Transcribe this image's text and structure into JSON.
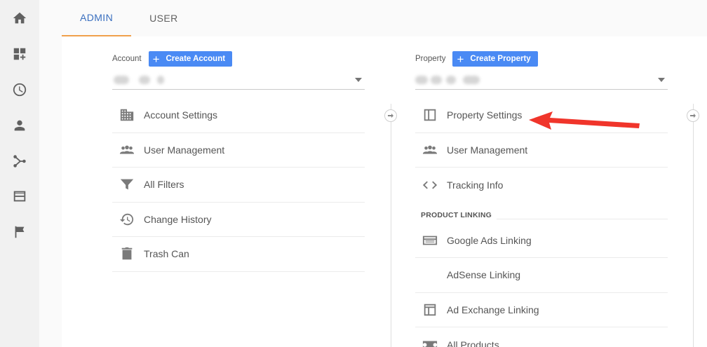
{
  "rail": {
    "icons": [
      "home-icon",
      "dashboards-icon",
      "realtime-icon",
      "audience-icon",
      "acquisition-icon",
      "behavior-icon",
      "conversions-icon"
    ]
  },
  "tabs": [
    {
      "label": "ADMIN",
      "active": true
    },
    {
      "label": "USER",
      "active": false
    }
  ],
  "account": {
    "label": "Account",
    "create_label": "Create Account",
    "items": [
      {
        "label": "Account Settings",
        "icon": "building-icon"
      },
      {
        "label": "User Management",
        "icon": "people-icon"
      },
      {
        "label": "All Filters",
        "icon": "filter-icon"
      },
      {
        "label": "Change History",
        "icon": "history-icon"
      },
      {
        "label": "Trash Can",
        "icon": "trash-icon"
      }
    ]
  },
  "property": {
    "label": "Property",
    "create_label": "Create Property",
    "items": [
      {
        "label": "Property Settings",
        "icon": "layout-icon"
      },
      {
        "label": "User Management",
        "icon": "people-icon"
      },
      {
        "label": "Tracking Info",
        "icon": "code-icon"
      }
    ],
    "section_label": "PRODUCT LINKING",
    "linking_items": [
      {
        "label": "Google Ads Linking",
        "icon": "ads-icon"
      },
      {
        "label": "AdSense Linking",
        "icon": ""
      },
      {
        "label": "Ad Exchange Linking",
        "icon": "layout-icon"
      },
      {
        "label": "All Products",
        "icon": "products-icon"
      }
    ]
  },
  "colors": {
    "accent": "#4a8af4",
    "tab_active": "#3a6fbf",
    "tab_underline": "#f0a04b",
    "arrow": "#f0352b"
  }
}
